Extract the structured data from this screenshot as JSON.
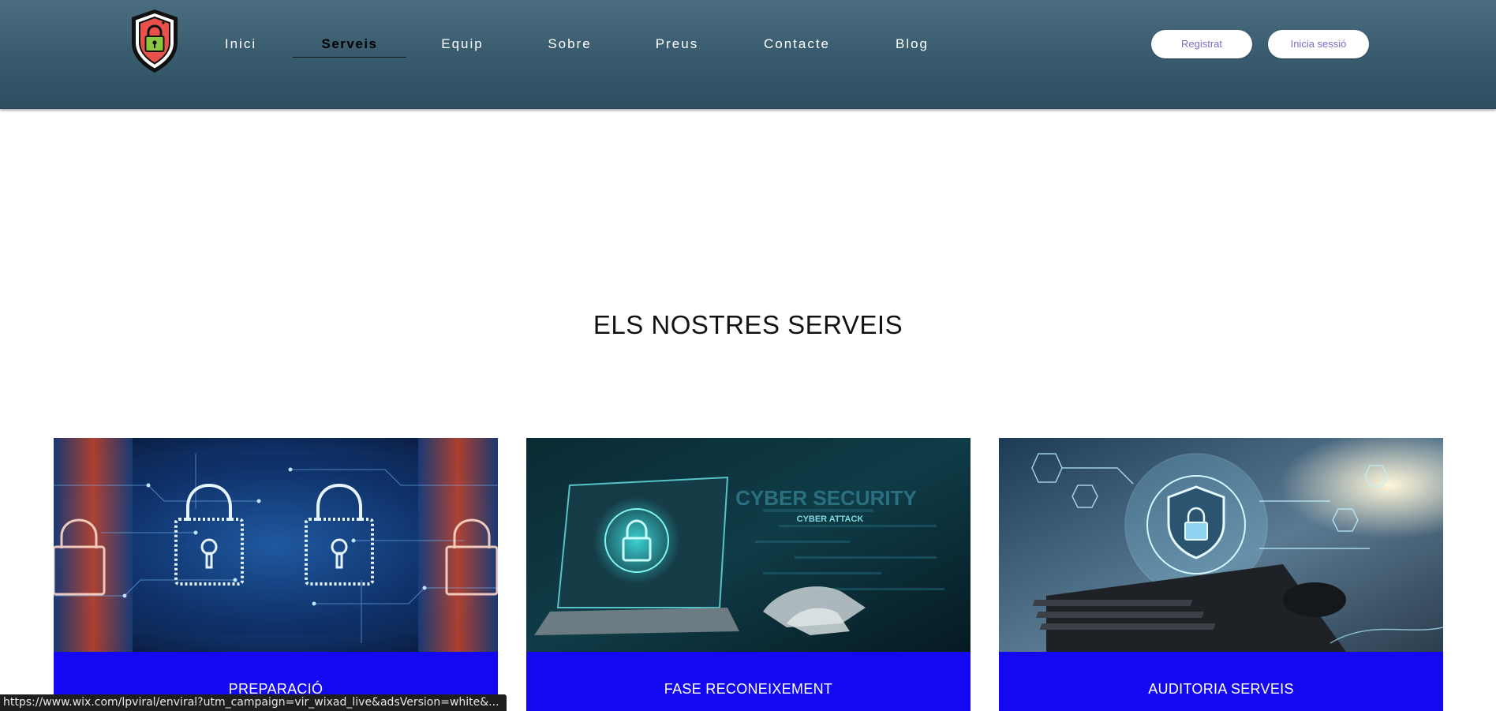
{
  "nav": {
    "items": [
      {
        "label": "Inici",
        "active": false
      },
      {
        "label": "Serveis",
        "active": true
      },
      {
        "label": "Equip",
        "active": false
      },
      {
        "label": "Sobre",
        "active": false
      },
      {
        "label": "Preus",
        "active": false
      },
      {
        "label": "Contacte",
        "active": false
      },
      {
        "label": "Blog",
        "active": false
      }
    ]
  },
  "auth": {
    "register_label": "Registrat",
    "login_label": "Inicia sessió"
  },
  "section": {
    "title": "ELS NOSTRES SERVEIS"
  },
  "cards": [
    {
      "title": "PREPARACIÓ"
    },
    {
      "title": "FASE RECONEIXEMENT"
    },
    {
      "title": "AUDITORIA SERVEIS"
    }
  ],
  "card2_image_text": {
    "headline": "CYBER SECURITY",
    "subline": "CYBER ATTACK"
  },
  "status_bar": {
    "url": "https://www.wix.com/lpviral/enviral?utm_campaign=vir_wixad_live&adsVersion=white&..."
  },
  "colors": {
    "header": "#3a5d70",
    "card_band": "#1408f2",
    "logo_shield": "#e8524a",
    "logo_lock": "#8dc63f",
    "pill_text": "#7a6ec6"
  },
  "icons": {
    "logo": "shield-lock-icon"
  }
}
